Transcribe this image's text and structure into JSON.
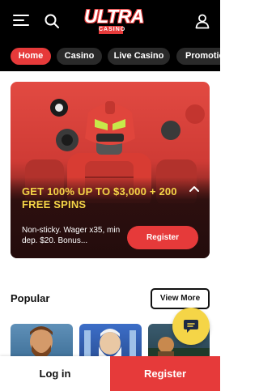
{
  "header": {
    "menu_icon": "hamburger-menu-icon",
    "search_icon": "search-icon",
    "logo_main": "ULTRA",
    "logo_sub": "CASINO",
    "user_icon": "user-icon"
  },
  "nav": {
    "pills": [
      {
        "label": "Home",
        "active": true
      },
      {
        "label": "Casino",
        "active": false
      },
      {
        "label": "Live Casino",
        "active": false
      },
      {
        "label": "Promotions",
        "active": false
      }
    ]
  },
  "banner": {
    "headline": "GET 100% UP TO $3,000 + 200 FREE SPINS",
    "terms": "Non-sticky. Wager x35, min dep. $20. Bonus...",
    "register_label": "Register",
    "collapse_icon": "chevron-up-icon"
  },
  "popular": {
    "title": "Popular",
    "view_more_label": "View More",
    "games": [
      {
        "icon": "game-thumbnail-bearded-man"
      },
      {
        "icon": "game-thumbnail-zeus"
      },
      {
        "icon": "game-thumbnail-adventure"
      }
    ]
  },
  "chat": {
    "icon": "chat-bubble-icon"
  },
  "bottom_bar": {
    "login_label": "Log in",
    "register_label": "Register"
  },
  "colors": {
    "accent_red": "#e63a3a",
    "accent_yellow": "#f5d547",
    "header_bg": "#000000"
  }
}
